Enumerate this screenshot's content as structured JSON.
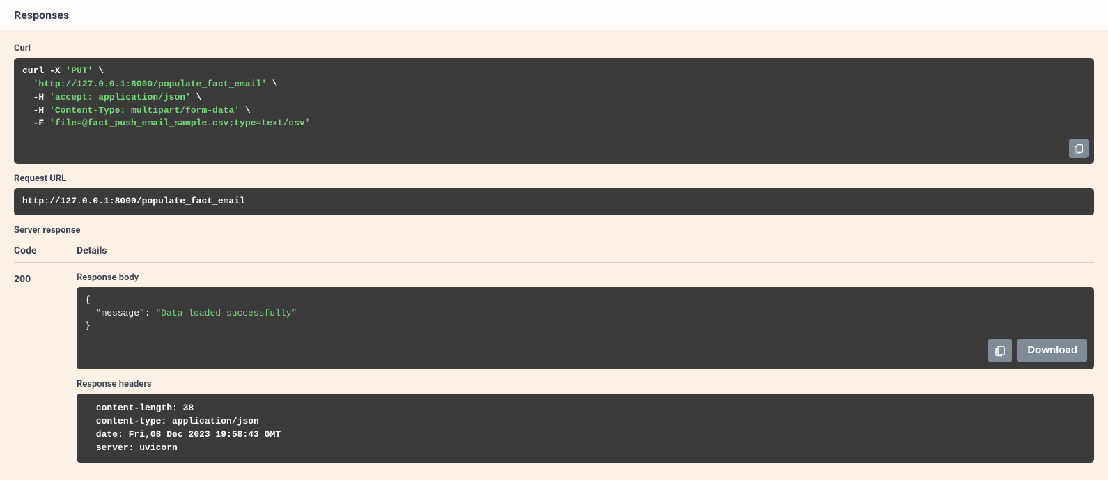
{
  "header": {
    "title": "Responses"
  },
  "curl": {
    "label": "Curl",
    "parts": {
      "l1a": "curl -X ",
      "l1b": "'PUT'",
      "l1c": " \\",
      "l2a": "  ",
      "l2b": "'http://127.0.0.1:8000/populate_fact_email'",
      "l2c": " \\",
      "l3a": "  -H ",
      "l3b": "'accept: application/json'",
      "l3c": " \\",
      "l4a": "  -H ",
      "l4b": "'Content-Type: multipart/form-data'",
      "l4c": " \\",
      "l5a": "  -F ",
      "l5b": "'file=@fact_push_email_sample.csv;type=text/csv'"
    }
  },
  "request_url": {
    "label": "Request URL",
    "value": "http://127.0.0.1:8000/populate_fact_email"
  },
  "server_response": {
    "label": "Server response",
    "code_header": "Code",
    "details_header": "Details",
    "status_code": "200",
    "response_body": {
      "label": "Response body",
      "open": "{",
      "key": "\"message\"",
      "colon": ": ",
      "value": "\"Data loaded successfully\"",
      "close": "}",
      "download_label": "Download"
    },
    "response_headers": {
      "label": "Response headers",
      "lines": " content-length: 38 \n content-type: application/json \n date: Fri,08 Dec 2023 19:58:43 GMT \n server: uvicorn "
    }
  }
}
